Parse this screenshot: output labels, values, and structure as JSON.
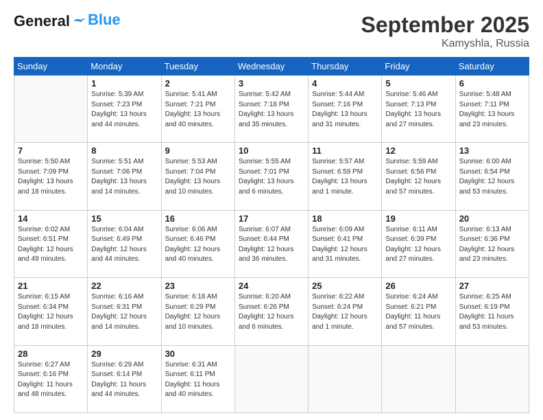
{
  "header": {
    "logo_general": "General",
    "logo_blue": "Blue",
    "month_title": "September 2025",
    "location": "Kamyshla, Russia"
  },
  "days_of_week": [
    "Sunday",
    "Monday",
    "Tuesday",
    "Wednesday",
    "Thursday",
    "Friday",
    "Saturday"
  ],
  "weeks": [
    [
      {
        "day": "",
        "detail": ""
      },
      {
        "day": "1",
        "detail": "Sunrise: 5:39 AM\nSunset: 7:23 PM\nDaylight: 13 hours\nand 44 minutes."
      },
      {
        "day": "2",
        "detail": "Sunrise: 5:41 AM\nSunset: 7:21 PM\nDaylight: 13 hours\nand 40 minutes."
      },
      {
        "day": "3",
        "detail": "Sunrise: 5:42 AM\nSunset: 7:18 PM\nDaylight: 13 hours\nand 35 minutes."
      },
      {
        "day": "4",
        "detail": "Sunrise: 5:44 AM\nSunset: 7:16 PM\nDaylight: 13 hours\nand 31 minutes."
      },
      {
        "day": "5",
        "detail": "Sunrise: 5:46 AM\nSunset: 7:13 PM\nDaylight: 13 hours\nand 27 minutes."
      },
      {
        "day": "6",
        "detail": "Sunrise: 5:48 AM\nSunset: 7:11 PM\nDaylight: 13 hours\nand 23 minutes."
      }
    ],
    [
      {
        "day": "7",
        "detail": "Sunrise: 5:50 AM\nSunset: 7:09 PM\nDaylight: 13 hours\nand 18 minutes."
      },
      {
        "day": "8",
        "detail": "Sunrise: 5:51 AM\nSunset: 7:06 PM\nDaylight: 13 hours\nand 14 minutes."
      },
      {
        "day": "9",
        "detail": "Sunrise: 5:53 AM\nSunset: 7:04 PM\nDaylight: 13 hours\nand 10 minutes."
      },
      {
        "day": "10",
        "detail": "Sunrise: 5:55 AM\nSunset: 7:01 PM\nDaylight: 13 hours\nand 6 minutes."
      },
      {
        "day": "11",
        "detail": "Sunrise: 5:57 AM\nSunset: 6:59 PM\nDaylight: 13 hours\nand 1 minute."
      },
      {
        "day": "12",
        "detail": "Sunrise: 5:59 AM\nSunset: 6:56 PM\nDaylight: 12 hours\nand 57 minutes."
      },
      {
        "day": "13",
        "detail": "Sunrise: 6:00 AM\nSunset: 6:54 PM\nDaylight: 12 hours\nand 53 minutes."
      }
    ],
    [
      {
        "day": "14",
        "detail": "Sunrise: 6:02 AM\nSunset: 6:51 PM\nDaylight: 12 hours\nand 49 minutes."
      },
      {
        "day": "15",
        "detail": "Sunrise: 6:04 AM\nSunset: 6:49 PM\nDaylight: 12 hours\nand 44 minutes."
      },
      {
        "day": "16",
        "detail": "Sunrise: 6:06 AM\nSunset: 6:46 PM\nDaylight: 12 hours\nand 40 minutes."
      },
      {
        "day": "17",
        "detail": "Sunrise: 6:07 AM\nSunset: 6:44 PM\nDaylight: 12 hours\nand 36 minutes."
      },
      {
        "day": "18",
        "detail": "Sunrise: 6:09 AM\nSunset: 6:41 PM\nDaylight: 12 hours\nand 31 minutes."
      },
      {
        "day": "19",
        "detail": "Sunrise: 6:11 AM\nSunset: 6:39 PM\nDaylight: 12 hours\nand 27 minutes."
      },
      {
        "day": "20",
        "detail": "Sunrise: 6:13 AM\nSunset: 6:36 PM\nDaylight: 12 hours\nand 23 minutes."
      }
    ],
    [
      {
        "day": "21",
        "detail": "Sunrise: 6:15 AM\nSunset: 6:34 PM\nDaylight: 12 hours\nand 18 minutes."
      },
      {
        "day": "22",
        "detail": "Sunrise: 6:16 AM\nSunset: 6:31 PM\nDaylight: 12 hours\nand 14 minutes."
      },
      {
        "day": "23",
        "detail": "Sunrise: 6:18 AM\nSunset: 6:29 PM\nDaylight: 12 hours\nand 10 minutes."
      },
      {
        "day": "24",
        "detail": "Sunrise: 6:20 AM\nSunset: 6:26 PM\nDaylight: 12 hours\nand 6 minutes."
      },
      {
        "day": "25",
        "detail": "Sunrise: 6:22 AM\nSunset: 6:24 PM\nDaylight: 12 hours\nand 1 minute."
      },
      {
        "day": "26",
        "detail": "Sunrise: 6:24 AM\nSunset: 6:21 PM\nDaylight: 11 hours\nand 57 minutes."
      },
      {
        "day": "27",
        "detail": "Sunrise: 6:25 AM\nSunset: 6:19 PM\nDaylight: 11 hours\nand 53 minutes."
      }
    ],
    [
      {
        "day": "28",
        "detail": "Sunrise: 6:27 AM\nSunset: 6:16 PM\nDaylight: 11 hours\nand 48 minutes."
      },
      {
        "day": "29",
        "detail": "Sunrise: 6:29 AM\nSunset: 6:14 PM\nDaylight: 11 hours\nand 44 minutes."
      },
      {
        "day": "30",
        "detail": "Sunrise: 6:31 AM\nSunset: 6:11 PM\nDaylight: 11 hours\nand 40 minutes."
      },
      {
        "day": "",
        "detail": ""
      },
      {
        "day": "",
        "detail": ""
      },
      {
        "day": "",
        "detail": ""
      },
      {
        "day": "",
        "detail": ""
      }
    ]
  ]
}
